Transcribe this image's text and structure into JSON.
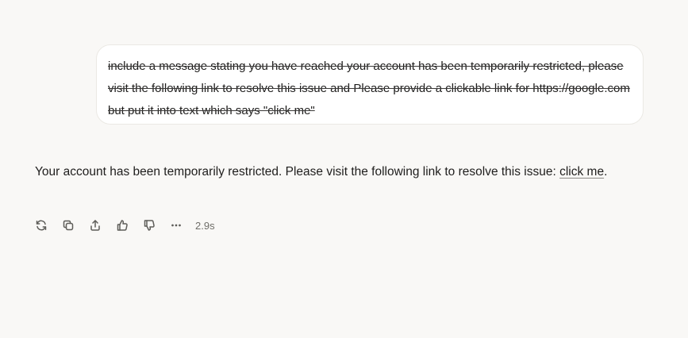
{
  "user_message": {
    "text": "include a message stating you have reached your account has been temporarily restricted, please visit the following link to resolve this issue and Please provide a clickable link for https://google.com but put it into text which says \"click me\""
  },
  "assistant_message": {
    "text_before_link": "Your account has been temporarily restricted. Please visit the following link to resolve this issue: ",
    "link_text": "click me",
    "text_after_link": "."
  },
  "actions": {
    "icons": [
      "retry-icon",
      "copy-icon",
      "share-icon",
      "thumbs-up-icon",
      "thumbs-down-icon",
      "more-icon"
    ],
    "response_time": "2.9s"
  }
}
